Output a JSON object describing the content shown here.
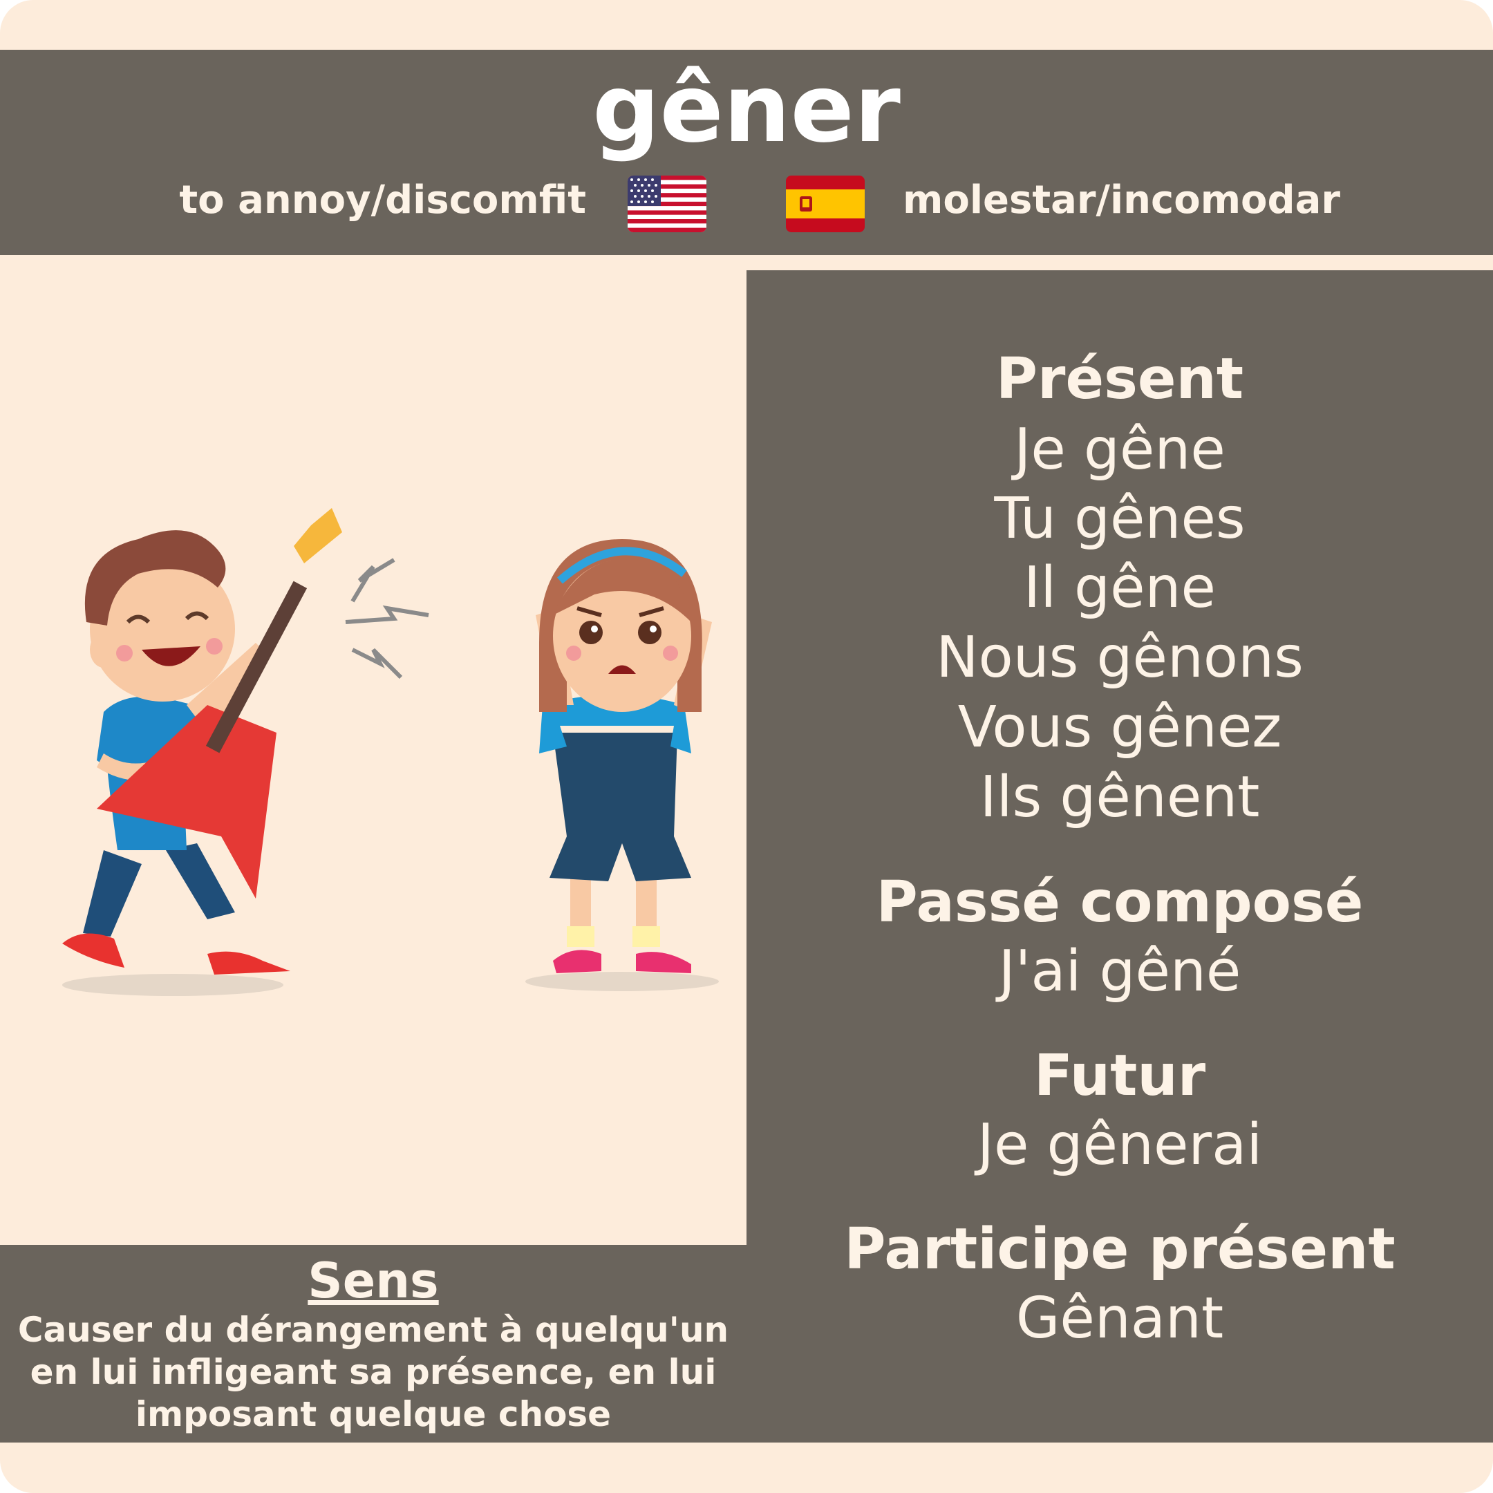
{
  "verb": "gêner",
  "translations": {
    "english": "to annoy/discomfit",
    "spanish": "molestar/incomodar"
  },
  "flags": {
    "english": "us-flag-icon",
    "spanish": "spain-flag-icon"
  },
  "tenses": {
    "present": {
      "label": "Présent",
      "forms": [
        "Je gêne",
        "Tu gênes",
        "Il gêne",
        "Nous gênons",
        "Vous gênez",
        "Ils gênent"
      ]
    },
    "passe_compose": {
      "label": "Passé composé",
      "form": "J'ai gêné"
    },
    "futur": {
      "label": "Futur",
      "form": "Je gênerai"
    },
    "participe_present": {
      "label": "Participe présent",
      "form": "Gênant"
    }
  },
  "sens": {
    "title": "Sens",
    "lines": [
      "Causer du dérangement à quelqu'un",
      "en lui infligeant sa présence, en lui",
      "imposant quelque chose"
    ]
  },
  "illustration": "boy-playing-guitar-and-annoyed-girl-illustration",
  "colors": {
    "background": "#fdecdb",
    "panel": "#6a645c",
    "text": "#fdf3e7"
  }
}
